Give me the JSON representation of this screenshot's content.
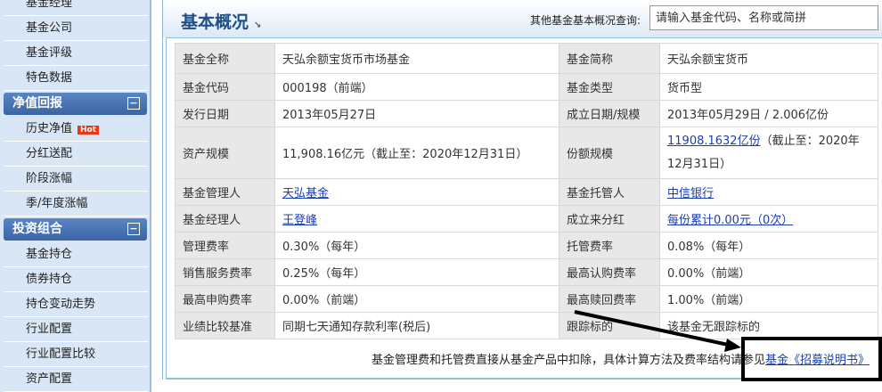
{
  "sidebar": {
    "top_items": [
      "基金经理",
      "基金公司",
      "基金评级",
      "特色数据"
    ],
    "sections": [
      {
        "title": "净值回报",
        "toggle": "−",
        "items": [
          "历史净值",
          "分红送配",
          "阶段涨幅",
          "季/年度涨幅"
        ],
        "hot_badge": "Hot"
      },
      {
        "title": "投资组合",
        "toggle": "−",
        "items": [
          "基金持仓",
          "债券持仓",
          "持仓变动走势",
          "行业配置",
          "行业配置比较",
          "资产配置"
        ]
      }
    ]
  },
  "header": {
    "title": "基本概况",
    "query_label": "其他基金基本概况查询:",
    "query_placeholder": "请输入基金代码、名称或简拼"
  },
  "table": [
    [
      "基金全称",
      "天弘余额宝货币市场基金",
      "基金简称",
      "天弘余额宝货币"
    ],
    [
      "基金代码",
      "000198（前端）",
      "基金类型",
      "货币型"
    ],
    [
      "发行日期",
      "2013年05月27日",
      "成立日期/规模",
      "2013年05月29日 / 2.006亿份"
    ],
    [
      "资产规模",
      "11,908.16亿元（截止至：2020年12月31日）",
      "份额规模",
      "11908.1632亿份",
      "（截止至：2020年12月31日）"
    ],
    [
      "基金管理人",
      "天弘基金",
      "基金托管人",
      "中信银行"
    ],
    [
      "基金经理人",
      "王登峰",
      "成立来分红",
      "每份累计0.00元（0次）"
    ],
    [
      "管理费率",
      "0.30%（每年）",
      "托管费率",
      "0.08%（每年）"
    ],
    [
      "销售服务费率",
      "0.25%（每年）",
      "最高认购费率",
      "0.00%（前端）"
    ],
    [
      "最高申购费率",
      "0.00%（前端）",
      "最高赎回费率",
      "1.00%（前端）"
    ],
    [
      "业绩比较基准",
      "同期七天通知存款利率(税后)",
      "跟踪标的",
      "该基金无跟踪标的"
    ]
  ],
  "note": {
    "text": "基金管理费和托管费直接从基金产品中扣除，具体计算方法及费率结构请参见",
    "link": "基金《招募说明书》"
  }
}
